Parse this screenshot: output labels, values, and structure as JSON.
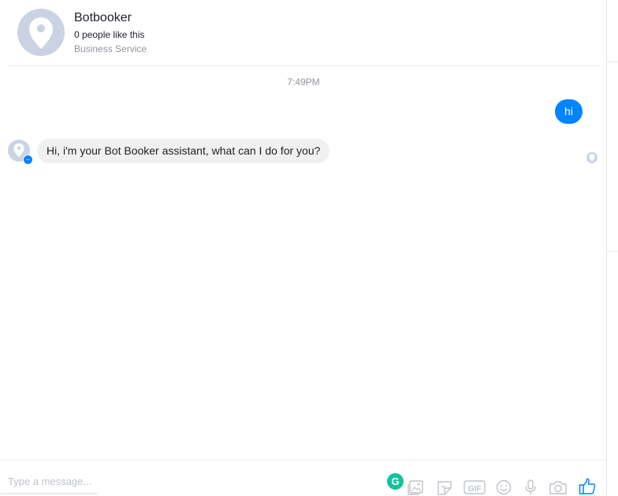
{
  "header": {
    "page_name": "Botbooker",
    "likes": "0 people like this",
    "category": "Business Service"
  },
  "conversation": {
    "timestamp": "7:49PM",
    "messages": [
      {
        "from": "user",
        "text": "hi"
      },
      {
        "from": "bot",
        "text": "Hi, i'm your Bot Booker assistant, what can I do for you?"
      }
    ]
  },
  "composer": {
    "placeholder": "Type a message...",
    "grammarly_letter": "G",
    "gif_label": "GIF",
    "icons": [
      "photo-icon",
      "sticker-icon",
      "gif-icon",
      "emoji-icon",
      "microphone-icon",
      "camera-icon",
      "thumbs-up-icon"
    ]
  },
  "colors": {
    "accent": "#0084ff",
    "avatar_bg": "#c9d3e3",
    "bubble_in": "#f1f0f0",
    "grammarly": "#15c39a",
    "muted_text": "#90949c",
    "icon_gray": "#bec3c9"
  }
}
